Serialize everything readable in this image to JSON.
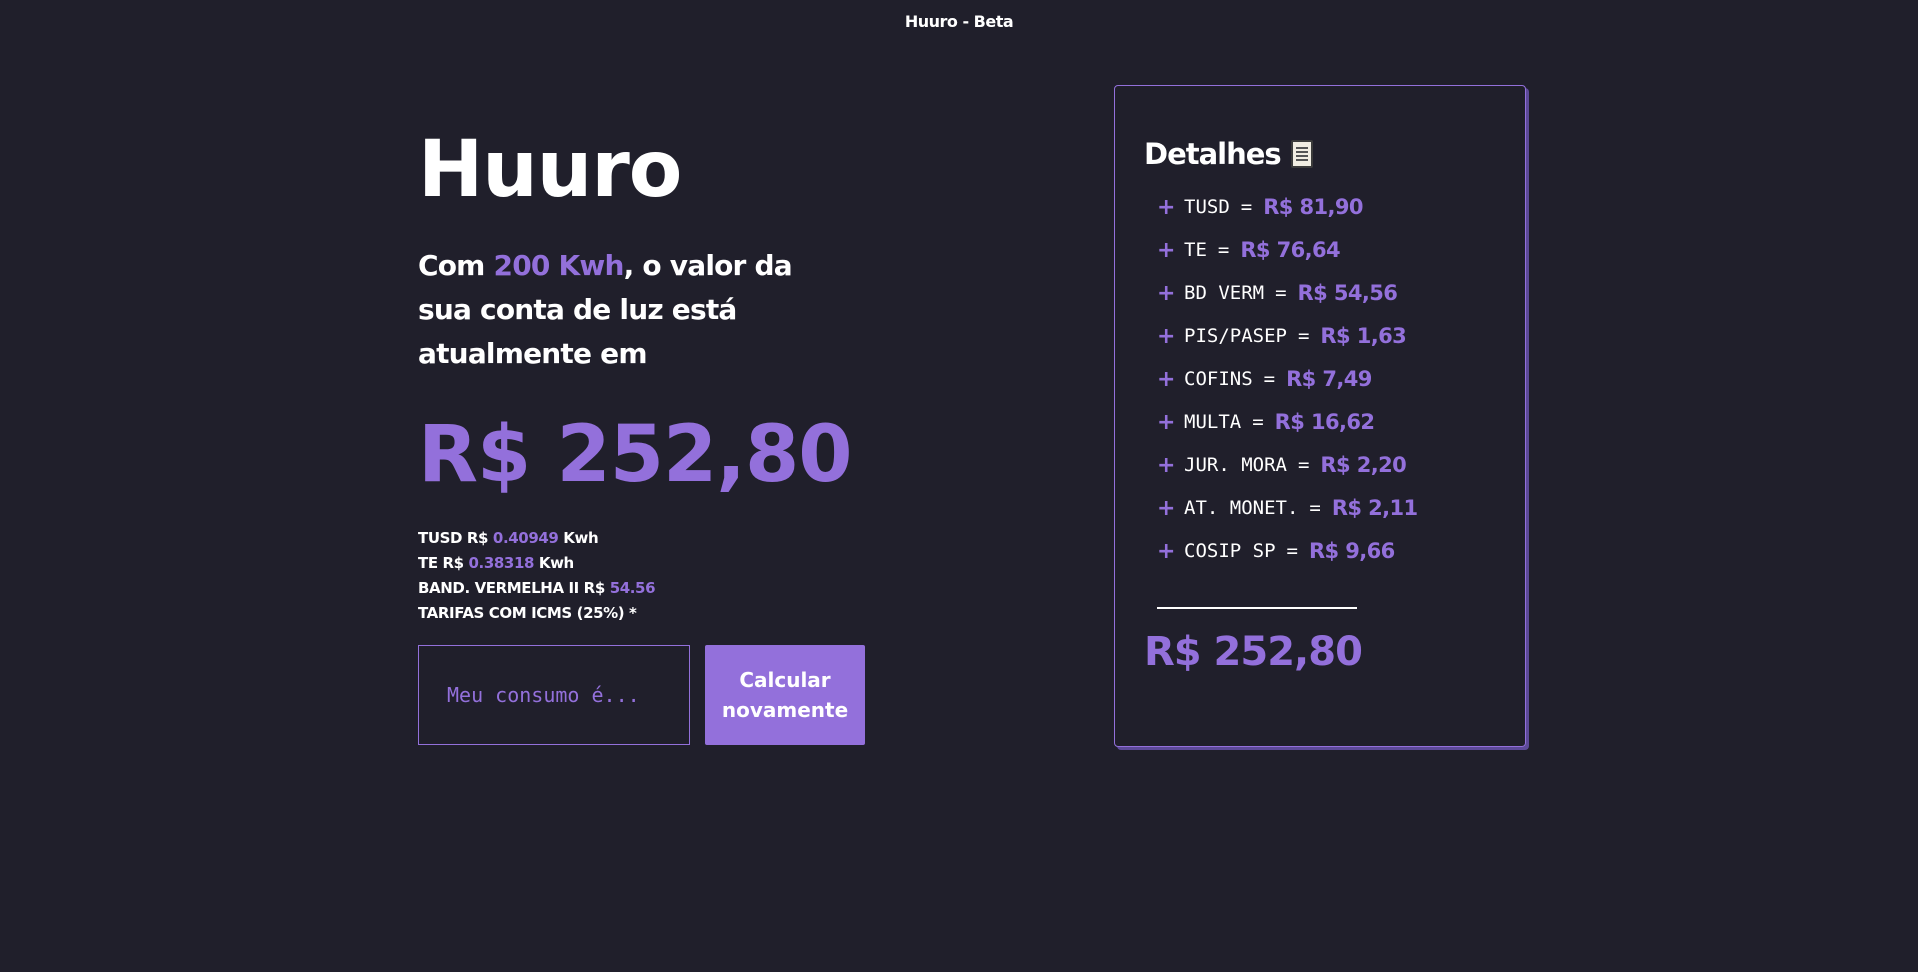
{
  "app": {
    "title": "Huuro - Beta"
  },
  "main": {
    "brand": "Huuro",
    "headline_prefix": "Com ",
    "headline_highlight": "200 Kwh",
    "headline_suffix": ", o valor da sua conta de luz está atualmente em",
    "total": "R$ 252,80",
    "rates": [
      {
        "label": "TUSD R$ ",
        "value": "0.40949",
        "unit": " Kwh"
      },
      {
        "label": "TE R$ ",
        "value": "0.38318",
        "unit": " Kwh"
      },
      {
        "label": "BAND. VERMELHA II R$ ",
        "value": "54.56",
        "unit": ""
      },
      {
        "label": "TARIFAS COM ICMS (25%) *",
        "value": "",
        "unit": ""
      }
    ],
    "input_placeholder": "Meu consumo é...",
    "button_label": "Calcular\nnovamente"
  },
  "details": {
    "title": "Detalhes",
    "icon": "scroll-icon",
    "items": [
      {
        "label": "TUSD",
        "value": "R$ 81,90"
      },
      {
        "label": "TE",
        "value": "R$ 76,64"
      },
      {
        "label": "BD VERM",
        "value": "R$ 54,56"
      },
      {
        "label": "PIS/PASEP",
        "value": "R$ 1,63"
      },
      {
        "label": "COFINS",
        "value": "R$ 7,49"
      },
      {
        "label": "MULTA",
        "value": "R$ 16,62"
      },
      {
        "label": "JUR. MORA",
        "value": "R$ 2,20"
      },
      {
        "label": "AT. MONET.",
        "value": "R$ 2,11"
      },
      {
        "label": "COSIP SP",
        "value": "R$ 9,66"
      }
    ],
    "total": "R$ 252,80"
  },
  "colors": {
    "background": "#201f2b",
    "accent": "#9370db",
    "text": "#ffffff"
  }
}
